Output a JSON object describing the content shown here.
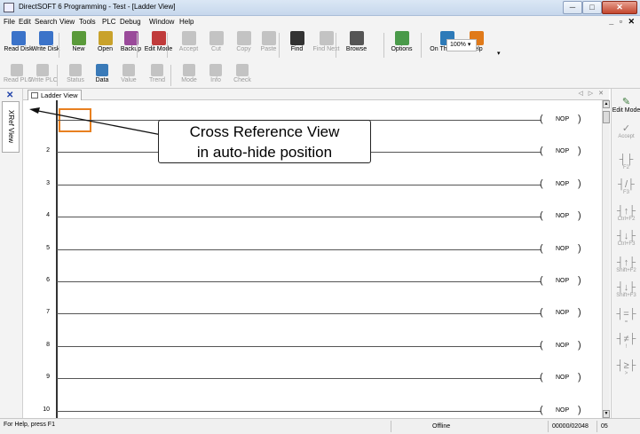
{
  "window": {
    "title": "DirectSOFT 6 Programming - Test - [Ladder View]"
  },
  "menu": [
    "File",
    "Edit",
    "Search",
    "View",
    "Tools",
    "PLC",
    "Debug",
    "Window",
    "Help"
  ],
  "toolbar1": [
    {
      "name": "read-disk",
      "label": "Read Disk",
      "enabled": true,
      "color": "#3b73c9"
    },
    {
      "name": "write-disk",
      "label": "Write Disk",
      "enabled": true,
      "color": "#3b73c9"
    },
    {
      "name": "new",
      "label": "New",
      "enabled": true,
      "color": "#5a9a3a"
    },
    {
      "name": "open",
      "label": "Open",
      "enabled": true,
      "color": "#c9a22b"
    },
    {
      "name": "backup",
      "label": "Backup",
      "enabled": true,
      "color": "#9a4a9a"
    },
    {
      "name": "edit-mode",
      "label": "Edit Mode",
      "enabled": true,
      "color": "#c03b3b"
    },
    {
      "name": "accept",
      "label": "Accept",
      "enabled": false,
      "color": "#8a8a8a"
    },
    {
      "name": "cut",
      "label": "Cut",
      "enabled": false,
      "color": "#8a8a8a"
    },
    {
      "name": "copy",
      "label": "Copy",
      "enabled": false,
      "color": "#8a8a8a"
    },
    {
      "name": "paste",
      "label": "Paste",
      "enabled": false,
      "color": "#8a8a8a"
    },
    {
      "name": "find",
      "label": "Find",
      "enabled": true,
      "color": "#333333"
    },
    {
      "name": "find-next",
      "label": "Find Next",
      "enabled": false,
      "color": "#8a8a8a"
    },
    {
      "name": "browse",
      "label": "Browse",
      "enabled": true,
      "color": "#555555"
    },
    {
      "name": "options",
      "label": "Options",
      "enabled": true,
      "color": "#4a9a4a"
    },
    {
      "name": "on-the-web",
      "label": "On The Web",
      "enabled": true,
      "color": "#2d7ab8"
    },
    {
      "name": "help",
      "label": "Help",
      "enabled": true,
      "color": "#e07a1a"
    }
  ],
  "zoom": "100%",
  "toolbar2": [
    {
      "name": "read-plc",
      "label": "Read PLC",
      "enabled": false
    },
    {
      "name": "write-plc",
      "label": "Write PLC",
      "enabled": false
    },
    {
      "name": "status",
      "label": "Status",
      "enabled": false
    },
    {
      "name": "data",
      "label": "Data",
      "enabled": true
    },
    {
      "name": "value",
      "label": "Value",
      "enabled": false
    },
    {
      "name": "trend",
      "label": "Trend",
      "enabled": false
    },
    {
      "name": "mode",
      "label": "Mode",
      "enabled": false
    },
    {
      "name": "info",
      "label": "Info",
      "enabled": false
    },
    {
      "name": "check",
      "label": "Check",
      "enabled": false
    }
  ],
  "xref_tab": "XRef View",
  "doc_tab": "Ladder View",
  "rungs": [
    {
      "num": "",
      "coil": "NOP"
    },
    {
      "num": "2",
      "coil": "NOP"
    },
    {
      "num": "3",
      "coil": "NOP"
    },
    {
      "num": "4",
      "coil": "NOP"
    },
    {
      "num": "5",
      "coil": "NOP"
    },
    {
      "num": "6",
      "coil": "NOP"
    },
    {
      "num": "7",
      "coil": "NOP"
    },
    {
      "num": "8",
      "coil": "NOP"
    },
    {
      "num": "9",
      "coil": "NOP"
    },
    {
      "num": "10",
      "coil": "NOP"
    }
  ],
  "right_panel": [
    {
      "label": "Edit Mode",
      "icon": "✎",
      "active": true
    },
    {
      "label": "Accept",
      "icon": "✓",
      "active": false
    },
    {
      "label": "F2",
      "icon": "┤├",
      "active": false
    },
    {
      "label": "F3",
      "icon": "┤/├",
      "active": false
    },
    {
      "label": "Ctrl+F2",
      "icon": "┤↑├",
      "active": false
    },
    {
      "label": "Ctrl+F3",
      "icon": "┤↓├",
      "active": false
    },
    {
      "label": "Shift+F2",
      "icon": "┤↑├",
      "active": false
    },
    {
      "label": "Shift+F3",
      "icon": "┤↓├",
      "active": false
    },
    {
      "label": "=",
      "icon": "┤=├",
      "active": false
    },
    {
      "label": "!",
      "icon": "┤≠├",
      "active": false
    },
    {
      "label": ">",
      "icon": "┤≥├",
      "active": false
    }
  ],
  "callout": {
    "line1": "Cross Reference View",
    "line2": "in auto-hide position"
  },
  "status": {
    "help": "For Help, press F1",
    "mode": "Offline",
    "count": "00000/02048",
    "rung": "05"
  }
}
